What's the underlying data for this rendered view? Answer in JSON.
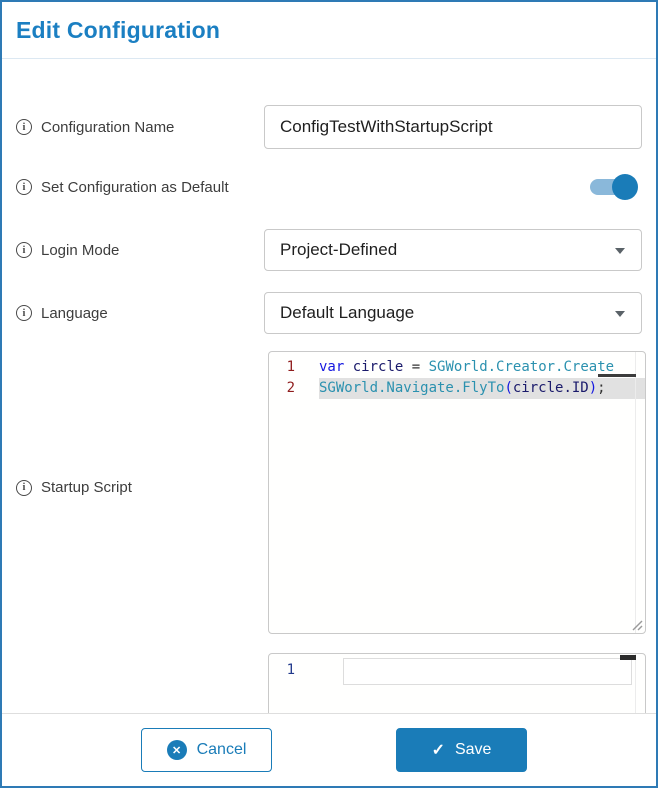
{
  "colors": {
    "accent": "#1a7cb8",
    "dialog_border": "#2e7ab5",
    "selection_bg": "#e1e1e1",
    "keyword": "#1417e0",
    "member": "#2b91af",
    "variable": "#1a1a6b",
    "line_number_editor1": "#8f1d1d",
    "line_number_editor2": "#223a8c"
  },
  "dialog": {
    "title": "Edit Configuration"
  },
  "fields": {
    "config_name": {
      "label": "Configuration Name",
      "value": "ConfigTestWithStartupScript"
    },
    "set_default": {
      "label": "Set Configuration as Default",
      "state": "on"
    },
    "login_mode": {
      "label": "Login Mode",
      "value": "Project-Defined"
    },
    "language": {
      "label": "Language",
      "value": "Default Language"
    },
    "startup_script": {
      "label": "Startup Script",
      "editor_lines": [
        {
          "number": "1",
          "selected": false,
          "tokens": [
            {
              "t": "keyword",
              "s": "var"
            },
            {
              "t": "plain",
              "s": " "
            },
            {
              "t": "variable",
              "s": "circle"
            },
            {
              "t": "plain",
              "s": " "
            },
            {
              "t": "operator",
              "s": "="
            },
            {
              "t": "plain",
              "s": " "
            },
            {
              "t": "member",
              "s": "SGWorld.Creator.Create"
            }
          ]
        },
        {
          "number": "2",
          "selected": true,
          "tokens": [
            {
              "t": "member",
              "s": "SGWorld.Navigate.FlyTo"
            },
            {
              "t": "paren",
              "s": "("
            },
            {
              "t": "variable",
              "s": "circle.ID"
            },
            {
              "t": "paren",
              "s": ")"
            },
            {
              "t": "punct",
              "s": ";"
            }
          ]
        }
      ]
    },
    "second_editor": {
      "first_line_number": "1"
    }
  },
  "icons": {
    "info": "i",
    "dropdown": "triangle-down",
    "cancel": "✕",
    "save": "✓"
  },
  "footer": {
    "cancel_label": "Cancel",
    "save_label": "Save"
  }
}
